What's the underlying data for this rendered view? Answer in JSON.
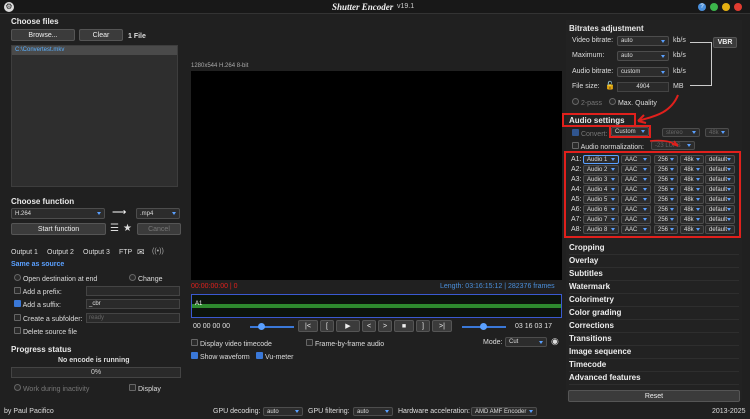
{
  "title": {
    "app": "Shutter Encoder",
    "version": "v19.1"
  },
  "files": {
    "header": "Choose files",
    "browse": "Browse...",
    "clear": "Clear",
    "count": "1 File",
    "items": [
      "C:\\Convertest.mkv"
    ]
  },
  "preview": {
    "info": "1280x544 H.264 8-bit",
    "time_in": "00:00:00:00 | 0",
    "length": "Length: 03:16:15:12 | 282376 frames",
    "track": "A1",
    "tc_start": "00 00 00 00",
    "tc_end": "03 16 03 17"
  },
  "controls": {
    "prev": "|<",
    "rw": "[",
    "play": "▶",
    "back": "<",
    "fwd": ">",
    "stop": "■",
    "ff": "]",
    "next": ">|"
  },
  "options": {
    "video_tc": "Display video timecode",
    "frame_audio": "Frame-by-frame audio",
    "show_wave": "Show waveform",
    "vu": "Vu-meter",
    "mode_label": "Mode:",
    "mode_value": "Cut"
  },
  "func": {
    "header": "Choose function",
    "value": "H.264",
    "ext": ".mp4",
    "start": "Start function",
    "cancel": "Cancel"
  },
  "out": {
    "tabs": [
      "Output 1",
      "Output 2",
      "Output 3",
      "FTP"
    ],
    "same": "Same as source",
    "open_dest": "Open destination at end",
    "change": "Change",
    "prefix": "Add a prefix:",
    "suffix": "Add a suffix:",
    "suffix_val": "_cbr",
    "subfolder": "Create a subfolder:",
    "subfolder_ph": "ready",
    "delete": "Delete source file"
  },
  "progress": {
    "header": "Progress status",
    "status": "No encode is running",
    "pct": "0%",
    "work": "Work during inactivity",
    "display": "Display"
  },
  "bitrates": {
    "header": "Bitrates adjustment",
    "video_label": "Video bitrate:",
    "video": "auto",
    "max_label": "Maximum:",
    "max": "auto",
    "audio_label": "Audio bitrate:",
    "audio": "custom",
    "unit": "kb/s",
    "size_label": "File size:",
    "size": "4904",
    "size_unit": "MB",
    "vbr": "VBR",
    "twopass": "2-pass",
    "maxq": "Max. Quality"
  },
  "audio": {
    "header": "Audio settings",
    "convert": "Convert:",
    "convert_val": "Custom",
    "stereo": "stereo",
    "khz": "48k",
    "norm": "Audio normalization:",
    "norm_val": "-23 LUFS",
    "tracks": [
      {
        "n": "A1:",
        "src": "Audio 1",
        "codec": "AAC",
        "br": "256",
        "hz": "48k",
        "d": "default"
      },
      {
        "n": "A2:",
        "src": "Audio 2",
        "codec": "AAC",
        "br": "256",
        "hz": "48k",
        "d": "default"
      },
      {
        "n": "A3:",
        "src": "Audio 3",
        "codec": "AAC",
        "br": "256",
        "hz": "48k",
        "d": "default"
      },
      {
        "n": "A4:",
        "src": "Audio 4",
        "codec": "AAC",
        "br": "256",
        "hz": "48k",
        "d": "default"
      },
      {
        "n": "A5:",
        "src": "Audio 5",
        "codec": "AAC",
        "br": "256",
        "hz": "48k",
        "d": "default"
      },
      {
        "n": "A6:",
        "src": "Audio 6",
        "codec": "AAC",
        "br": "256",
        "hz": "48k",
        "d": "default"
      },
      {
        "n": "A7:",
        "src": "Audio 7",
        "codec": "AAC",
        "br": "256",
        "hz": "48k",
        "d": "default"
      },
      {
        "n": "A8:",
        "src": "Audio 8",
        "codec": "AAC",
        "br": "256",
        "hz": "48k",
        "d": "default"
      }
    ]
  },
  "sections": [
    "Cropping",
    "Overlay",
    "Subtitles",
    "Watermark",
    "Colorimetry",
    "Color grading",
    "Corrections",
    "Transitions",
    "Image sequence",
    "Timecode",
    "Advanced features"
  ],
  "reset": "Reset",
  "footer": {
    "author": "by Paul Pacifico",
    "gpu_dec": "GPU decoding:",
    "gpu_dec_val": "auto",
    "gpu_filt": "GPU filtering:",
    "gpu_filt_val": "auto",
    "hw": "Hardware acceleration:",
    "hw_val": "AMD AMF Encoder",
    "years": "2013-2025"
  }
}
